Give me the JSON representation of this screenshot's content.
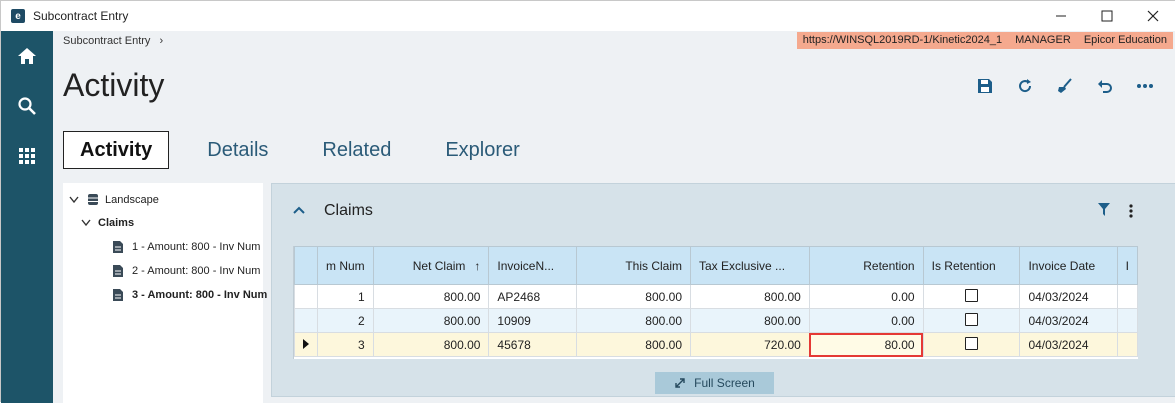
{
  "window": {
    "title": "Subcontract Entry",
    "minimize": "—",
    "maximize": "☐",
    "close": "✕"
  },
  "rail": {
    "items": [
      "home",
      "search",
      "apps"
    ]
  },
  "breadcrumb": {
    "text": "Subcontract Entry",
    "sep": "›"
  },
  "connection": {
    "url": "https://WINSQL2019RD-1/Kinetic2024_1",
    "user": "MANAGER",
    "company": "Epicor Education"
  },
  "page": {
    "title": "Activity"
  },
  "tabs": [
    {
      "label": "Activity",
      "active": true
    },
    {
      "label": "Details",
      "active": false
    },
    {
      "label": "Related",
      "active": false
    },
    {
      "label": "Explorer",
      "active": false
    }
  ],
  "tree": {
    "root": "Landscape",
    "group": "Claims",
    "items": [
      "1 - Amount: 800 - Inv Num",
      "2 - Amount: 800 - Inv Num",
      "3 - Amount: 800 - Inv Num"
    ]
  },
  "panel": {
    "title": "Claims"
  },
  "grid": {
    "columns": [
      "m Num",
      "Net Claim",
      "InvoiceN...",
      "This Claim",
      "Tax Exclusive ...",
      "Retention",
      "Is Retention",
      "Invoice Date",
      "I"
    ],
    "sort_indicator": "↑",
    "rows": [
      {
        "num": "1",
        "net": "800.00",
        "inv": "AP2468",
        "this": "800.00",
        "tax": "800.00",
        "ret": "0.00",
        "isret": false,
        "date": "04/03/2024"
      },
      {
        "num": "2",
        "net": "800.00",
        "inv": "10909",
        "this": "800.00",
        "tax": "800.00",
        "ret": "0.00",
        "isret": false,
        "date": "04/03/2024"
      },
      {
        "num": "3",
        "net": "800.00",
        "inv": "45678",
        "this": "800.00",
        "tax": "720.00",
        "ret": "80.00",
        "isret": false,
        "date": "04/03/2024"
      }
    ]
  },
  "fullscreen": {
    "label": "Full Screen"
  }
}
